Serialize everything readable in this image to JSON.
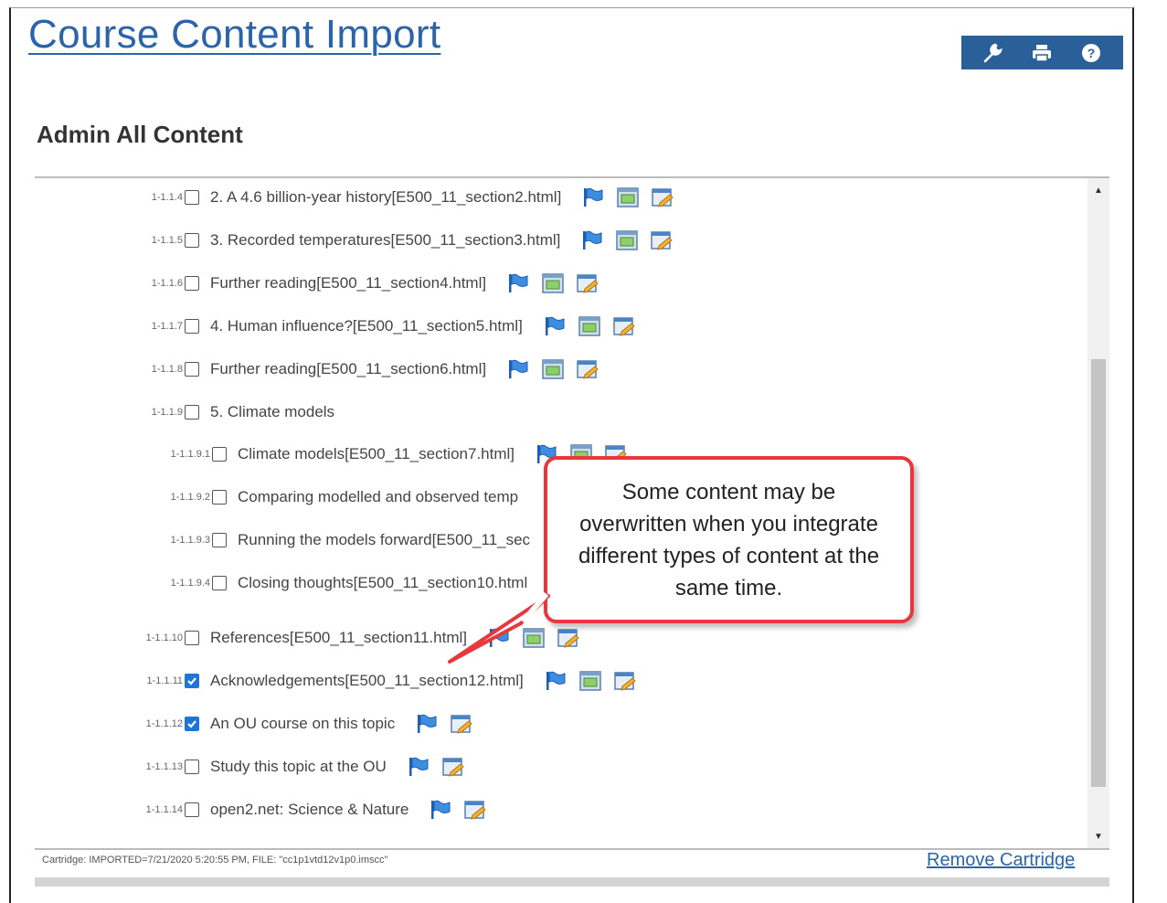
{
  "header": {
    "title": "Course Content Import"
  },
  "toolbar": {
    "icons": [
      "wrench-icon",
      "print-icon",
      "help-icon"
    ]
  },
  "section": {
    "title": "Admin All Content"
  },
  "items": [
    {
      "num": "1-1.1.4",
      "label": "2. A 4.6 billion-year history[E500_11_section2.html]",
      "checked": false,
      "icons": [
        "flag",
        "page",
        "edit"
      ]
    },
    {
      "num": "1-1.1.5",
      "label": "3. Recorded temperatures[E500_11_section3.html]",
      "checked": false,
      "icons": [
        "flag",
        "page",
        "edit"
      ]
    },
    {
      "num": "1-1.1.6",
      "label": "Further reading[E500_11_section4.html]",
      "checked": false,
      "icons": [
        "flag",
        "page",
        "edit"
      ]
    },
    {
      "num": "1-1.1.7",
      "label": "4. Human influence?[E500_11_section5.html]",
      "checked": false,
      "icons": [
        "flag",
        "page",
        "edit"
      ]
    },
    {
      "num": "1-1.1.8",
      "label": "Further reading[E500_11_section6.html]",
      "checked": false,
      "icons": [
        "flag",
        "page",
        "edit"
      ]
    },
    {
      "num": "1-1.1.9",
      "label": "5. Climate models",
      "checked": false,
      "icons": []
    },
    {
      "num": "1-1.1.9.1",
      "label": "Climate models[E500_11_section7.html]",
      "checked": false,
      "icons": [
        "flag",
        "page",
        "edit"
      ]
    },
    {
      "num": "1-1.1.9.2",
      "label": "Comparing modelled and observed temp",
      "checked": false,
      "icons": []
    },
    {
      "num": "1-1.1.9.3",
      "label": "Running the models forward[E500_11_sec",
      "checked": false,
      "icons": []
    },
    {
      "num": "1-1.1.9.4",
      "label": "Closing thoughts[E500_11_section10.html",
      "checked": false,
      "icons": []
    },
    {
      "num": "1-1.1.10",
      "label": "References[E500_11_section11.html]",
      "checked": false,
      "icons": [
        "flag",
        "page",
        "edit"
      ]
    },
    {
      "num": "1-1.1.11",
      "label": "Acknowledgements[E500_11_section12.html]",
      "checked": true,
      "icons": [
        "flag",
        "page",
        "edit"
      ]
    },
    {
      "num": "1-1.1.12",
      "label": "An OU course on this topic",
      "checked": true,
      "icons": [
        "flag",
        "edit"
      ]
    },
    {
      "num": "1-1.1.13",
      "label": "Study this topic at the OU",
      "checked": false,
      "icons": [
        "flag",
        "edit"
      ]
    },
    {
      "num": "1-1.1.14",
      "label": "open2.net: Science & Nature",
      "checked": false,
      "icons": [
        "flag",
        "edit"
      ]
    }
  ],
  "callout": {
    "text": "Some content may be overwritten when you integrate different types of content at the same time."
  },
  "footer": {
    "cartridge_info": "Cartridge: IMPORTED=7/21/2020 5:20:55 PM, FILE: \"cc1p1vtd12v1p0.imscc\"",
    "remove_label": "Remove Cartridge"
  },
  "colors": {
    "accent": "#2b64a8",
    "toolbar": "#2b5f99",
    "callout_border": "#e8383d",
    "check": "#1e74d8"
  }
}
